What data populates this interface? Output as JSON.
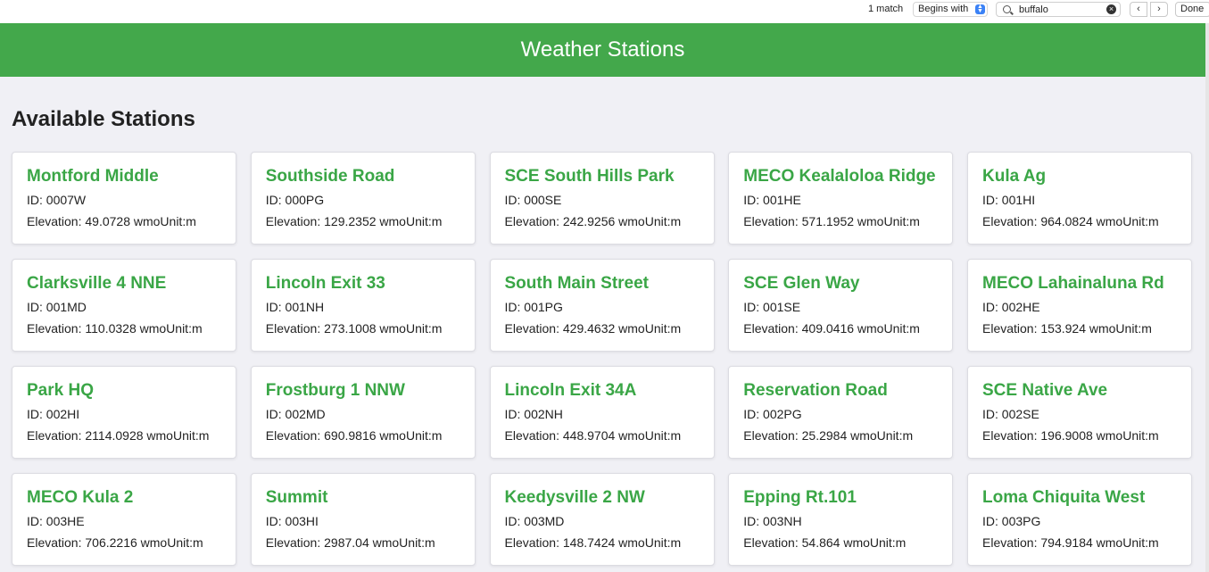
{
  "find_bar": {
    "match_count": "1 match",
    "mode": "Begins with",
    "query": "buffalo",
    "prev_icon": "chevron-left-icon",
    "next_icon": "chevron-right-icon",
    "done_label": "Done"
  },
  "header": {
    "title": "Weather Stations",
    "background_color": "#43a84b"
  },
  "main": {
    "section_title": "Available Stations",
    "stations": [
      {
        "name": "Montford Middle",
        "id": "ID: 0007W",
        "elevation": "Elevation: 49.0728 wmoUnit:m"
      },
      {
        "name": "Southside Road",
        "id": "ID: 000PG",
        "elevation": "Elevation: 129.2352 wmoUnit:m"
      },
      {
        "name": "SCE South Hills Park",
        "id": "ID: 000SE",
        "elevation": "Elevation: 242.9256 wmoUnit:m"
      },
      {
        "name": "MECO Kealaloloa Ridge",
        "id": "ID: 001HE",
        "elevation": "Elevation: 571.1952 wmoUnit:m"
      },
      {
        "name": "Kula Ag",
        "id": "ID: 001HI",
        "elevation": "Elevation: 964.0824 wmoUnit:m"
      },
      {
        "name": "Clarksville 4 NNE",
        "id": "ID: 001MD",
        "elevation": "Elevation: 110.0328 wmoUnit:m"
      },
      {
        "name": "Lincoln Exit 33",
        "id": "ID: 001NH",
        "elevation": "Elevation: 273.1008 wmoUnit:m"
      },
      {
        "name": "South Main Street",
        "id": "ID: 001PG",
        "elevation": "Elevation: 429.4632 wmoUnit:m"
      },
      {
        "name": "SCE Glen Way",
        "id": "ID: 001SE",
        "elevation": "Elevation: 409.0416 wmoUnit:m"
      },
      {
        "name": "MECO Lahainaluna Rd",
        "id": "ID: 002HE",
        "elevation": "Elevation: 153.924 wmoUnit:m"
      },
      {
        "name": "Park HQ",
        "id": "ID: 002HI",
        "elevation": "Elevation: 2114.0928 wmoUnit:m"
      },
      {
        "name": "Frostburg 1 NNW",
        "id": "ID: 002MD",
        "elevation": "Elevation: 690.9816 wmoUnit:m"
      },
      {
        "name": "Lincoln Exit 34A",
        "id": "ID: 002NH",
        "elevation": "Elevation: 448.9704 wmoUnit:m"
      },
      {
        "name": "Reservation Road",
        "id": "ID: 002PG",
        "elevation": "Elevation: 25.2984 wmoUnit:m"
      },
      {
        "name": "SCE Native Ave",
        "id": "ID: 002SE",
        "elevation": "Elevation: 196.9008 wmoUnit:m"
      },
      {
        "name": "MECO Kula 2",
        "id": "ID: 003HE",
        "elevation": "Elevation: 706.2216 wmoUnit:m"
      },
      {
        "name": "Summit",
        "id": "ID: 003HI",
        "elevation": "Elevation: 2987.04 wmoUnit:m"
      },
      {
        "name": "Keedysville 2 NW",
        "id": "ID: 003MD",
        "elevation": "Elevation: 148.7424 wmoUnit:m"
      },
      {
        "name": "Epping Rt.101",
        "id": "ID: 003NH",
        "elevation": "Elevation: 54.864 wmoUnit:m"
      },
      {
        "name": "Loma Chiquita West",
        "id": "ID: 003PG",
        "elevation": "Elevation: 794.9184 wmoUnit:m"
      }
    ]
  }
}
